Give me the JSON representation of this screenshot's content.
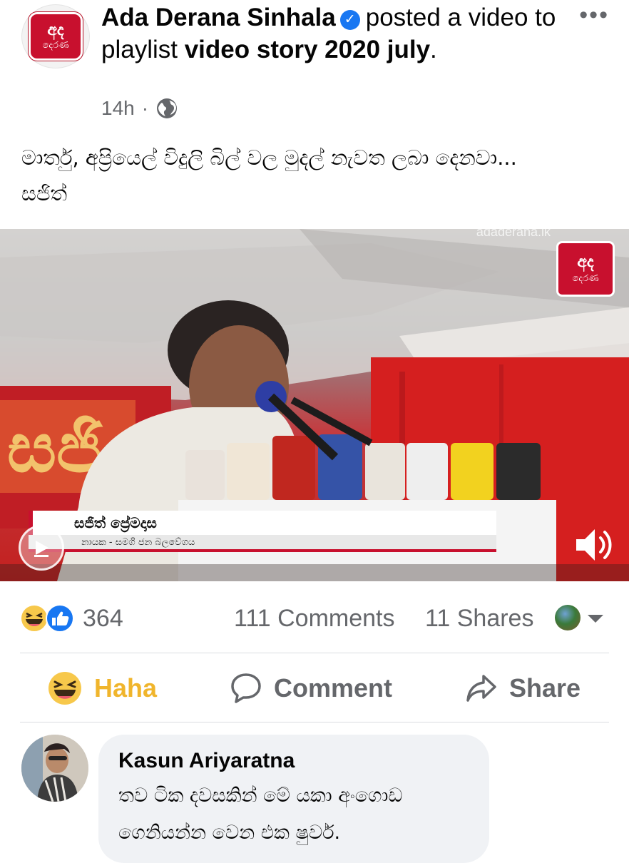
{
  "post": {
    "author": "Ada Derana Sinhala",
    "action_text": "posted a video to playlist",
    "playlist": "video story 2020 july",
    "period": ".",
    "time": "14h",
    "separator": "·",
    "privacy_icon": "globe-icon",
    "more_icon": "more-options-icon",
    "text_line_1": "මාර්තු, අප්‍රියෙල් විදුලි බිල් වල මුදල් නැවත ලබා දෙනවා...",
    "text_line_2": "සජිත්"
  },
  "logo": {
    "line_1": "අද",
    "line_2": "දෙරණ"
  },
  "video": {
    "watermark": "adaderana.lk",
    "lower_third_name": "සජිත් ප්‍රේමදාස",
    "lower_third_title": "නායක - සමගි ජන බලවේගය",
    "play_icon": "play-icon",
    "volume_icon": "volume-icon"
  },
  "summary": {
    "reaction_count": "364",
    "comments": "111 Comments",
    "shares": "11 Shares",
    "reaction_icons": [
      "haha-icon",
      "like-icon"
    ]
  },
  "actions": {
    "haha": "Haha",
    "comment": "Comment",
    "share": "Share"
  },
  "comment": {
    "author": "Kasun Ariyaratna",
    "text_line_1": "තව ටික දවසකින් මේ යකා අංගොඩ",
    "text_line_2": "ගෙනියන්න වෙන එක ෂුවර්."
  },
  "colors": {
    "facebook_blue": "#1877f2",
    "haha_yellow": "#f0b52c",
    "meta_gray": "#65676b",
    "derana_red": "#c8102e",
    "comment_bubble": "#f0f2f5"
  }
}
